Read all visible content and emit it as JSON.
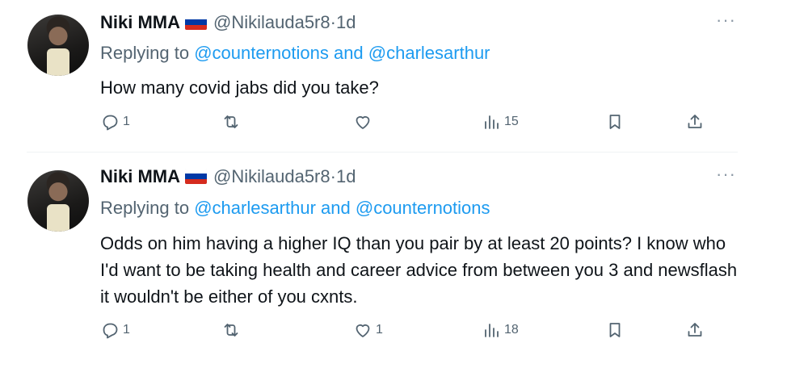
{
  "tweets": [
    {
      "author": "Niki MMA",
      "flag": "russia-flag",
      "handle": "@Nikilauda5r8",
      "separator": "·",
      "time": "1d",
      "replying_prefix": "Replying to ",
      "replying_to_1": "@counternotions",
      "replying_join": " and ",
      "replying_to_2": "@charlesarthur",
      "text": "How many covid jabs did you take?",
      "more": "···",
      "reply_count": "1",
      "repost_count": "",
      "like_count": "",
      "views_count": "15"
    },
    {
      "author": "Niki MMA",
      "flag": "russia-flag",
      "handle": "@Nikilauda5r8",
      "separator": "·",
      "time": "1d",
      "replying_prefix": "Replying to ",
      "replying_to_1": "@charlesarthur",
      "replying_join": " and ",
      "replying_to_2": "@counternotions",
      "text": "Odds on him having a higher IQ than you pair by at least 20 points? I know who I'd want to be taking health and career advice from between you 3 and newsflash it wouldn't be either of you cxnts.",
      "more": "···",
      "reply_count": "1",
      "repost_count": "",
      "like_count": "1",
      "views_count": "18"
    }
  ],
  "colors": {
    "text": "#0f1419",
    "secondary": "#536471",
    "link": "#1d9bf0",
    "divider": "#eff3f4"
  }
}
